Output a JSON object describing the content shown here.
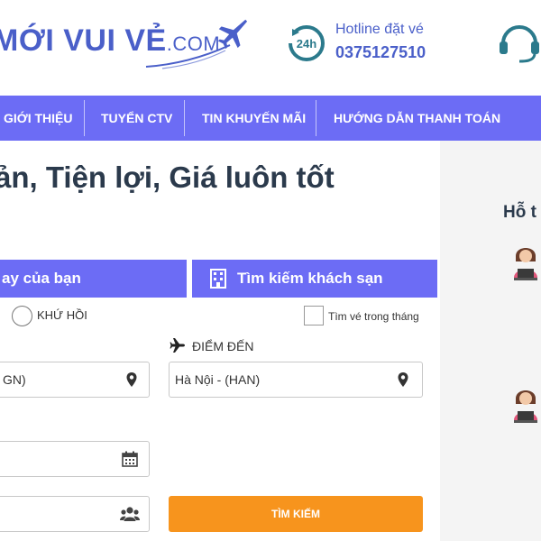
{
  "header": {
    "logo_text": "MỚI VUI VẺ",
    "logo_domain": ".COM",
    "hotline_label": "Hotline đặt vé",
    "hotline_number": "0375127510"
  },
  "nav": {
    "items": [
      {
        "label": "GIỚI THIỆU"
      },
      {
        "label": "TUYỂN CTV"
      },
      {
        "label": "TIN KHUYẾN MÃI"
      },
      {
        "label": "HƯỚNG DẪN THANH TOÁN"
      }
    ]
  },
  "main": {
    "headline": "ản, Tiện lợi, Giá luôn tốt",
    "tabs": {
      "flight": "ay của bạn",
      "hotel": "Tìm kiếm khách sạn"
    },
    "round_trip_label": "KHỨ HỒI",
    "month_search_label": "Tìm vé trong tháng",
    "destination_label": "ĐIỂM ĐẾN",
    "origin_value": "GN)",
    "destination_value": "Hà Nội - (HAN)",
    "date_value": "",
    "passengers_value": "",
    "search_button": "TÌM KIẾM"
  },
  "sidebar": {
    "title": "Hỗ t"
  },
  "colors": {
    "brand": "#6c6cf5",
    "logo": "#4a5fc9",
    "accent": "#f7941d",
    "heading": "#2b3a4c"
  }
}
